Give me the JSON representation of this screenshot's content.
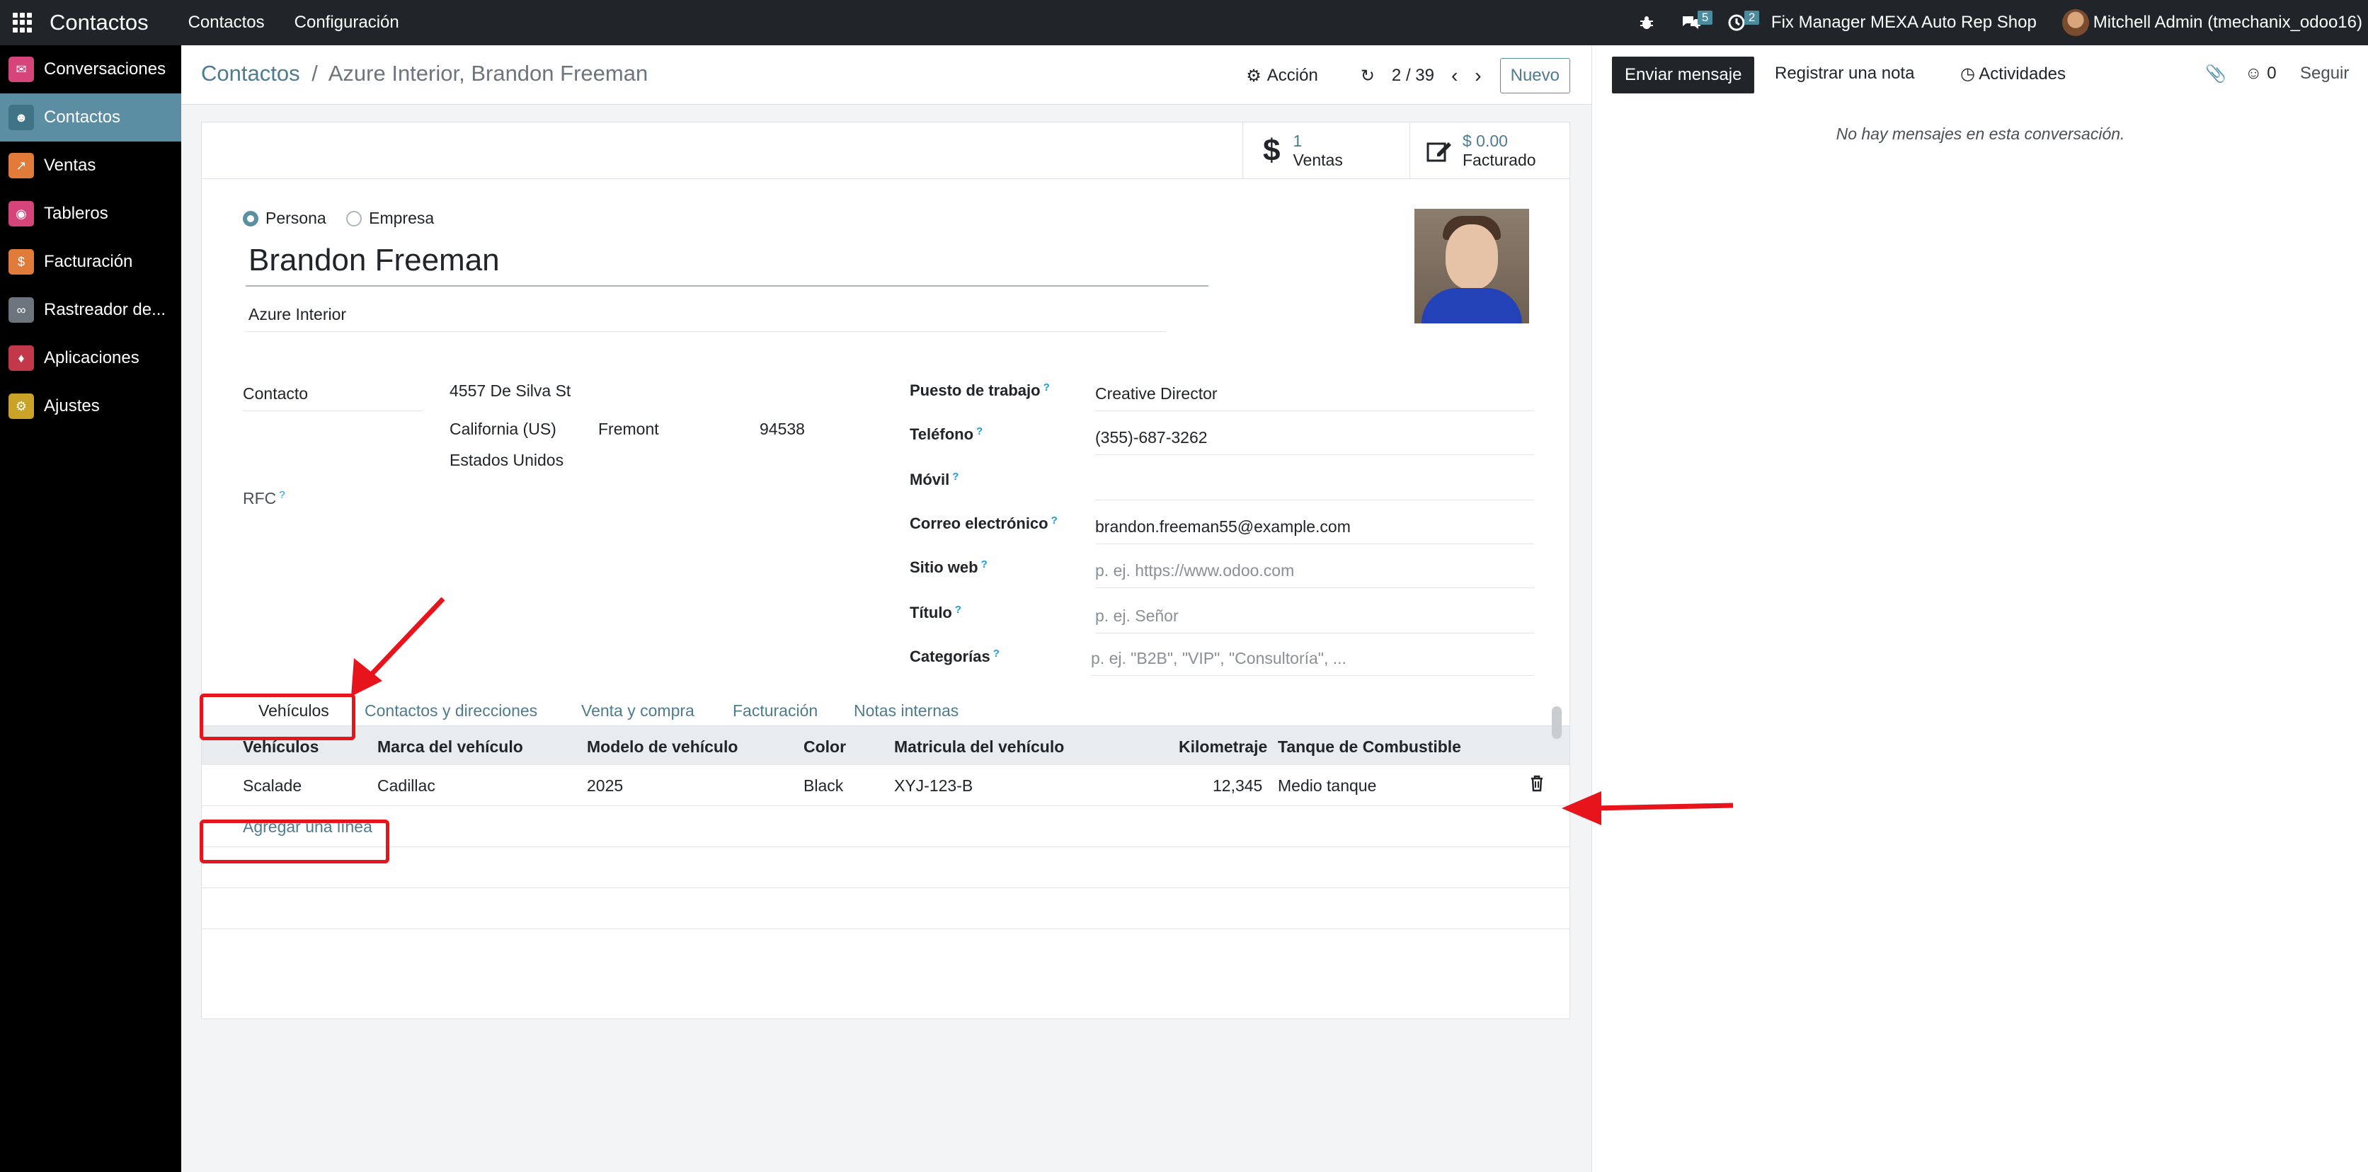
{
  "topbar": {
    "app_name": "Contactos",
    "menu": [
      "Contactos",
      "Configuración"
    ],
    "messages_badge": "5",
    "activities_badge": "2",
    "company": "Fix Manager MEXA Auto Rep Shop",
    "user": "Mitchell Admin (tmechanix_odoo16)"
  },
  "sidebar": {
    "items": [
      {
        "label": "Conversaciones",
        "color": "#d6457a",
        "icon": "chat-icon"
      },
      {
        "label": "Contactos",
        "color": "#5b8ea2",
        "icon": "contacts-icon"
      },
      {
        "label": "Ventas",
        "color": "#e07b39",
        "icon": "chart-icon"
      },
      {
        "label": "Tableros",
        "color": "#d6457a",
        "icon": "dashboard-icon"
      },
      {
        "label": "Facturación",
        "color": "#e07b39",
        "icon": "invoice-icon"
      },
      {
        "label": "Rastreador de...",
        "color": "#6c757d",
        "icon": "link-icon"
      },
      {
        "label": "Aplicaciones",
        "color": "#c2384a",
        "icon": "apps-icon"
      },
      {
        "label": "Ajustes",
        "color": "#c9a227",
        "icon": "gear-icon"
      }
    ]
  },
  "breadcrumb": {
    "root": "Contactos",
    "separator": "/",
    "current": "Azure Interior, Brandon Freeman"
  },
  "controls": {
    "action": "Acción",
    "pager": "2 / 39",
    "new": "Nuevo"
  },
  "stats": {
    "sales_count": "1",
    "sales_label": "Ventas",
    "invoiced_amount": "$ 0.00",
    "invoiced_label": "Facturado"
  },
  "form": {
    "type_person": "Persona",
    "type_company": "Empresa",
    "name": "Brandon Freeman",
    "company": "Azure Interior",
    "address_type": "Contacto",
    "street": "4557 De Silva St",
    "state": "California (US)",
    "city": "Fremont",
    "zip": "94538",
    "country": "Estados Unidos",
    "rfc_label": "RFC",
    "job_label": "Puesto de trabajo",
    "job_value": "Creative Director",
    "phone_label": "Teléfono",
    "phone_value": "(355)-687-3262",
    "mobile_label": "Móvil",
    "email_label": "Correo electrónico",
    "email_value": "brandon.freeman55@example.com",
    "website_label": "Sitio web",
    "website_placeholder": "p. ej. https://www.odoo.com",
    "title_label": "Título",
    "title_placeholder": "p. ej. Señor",
    "tags_label": "Categorías",
    "tags_placeholder": "p. ej. \"B2B\", \"VIP\", \"Consultoría\", ..."
  },
  "tabs": [
    "Vehículos",
    "Contactos y direcciones",
    "Venta y compra",
    "Facturación",
    "Notas internas"
  ],
  "vehicles": {
    "headers": [
      "Vehículos",
      "Marca del vehículo",
      "Modelo de vehículo",
      "Color",
      "Matricula del vehículo",
      "Kilometraje",
      "Tanque de Combustible"
    ],
    "rows": [
      [
        "Scalade",
        "Cadillac",
        "2025",
        "Black",
        "XYJ-123-B",
        "12,345",
        "Medio tanque"
      ]
    ],
    "add_line": "Agregar una línea"
  },
  "chatter": {
    "send": "Enviar mensaje",
    "note": "Registrar una nota",
    "activities": "Actividades",
    "followers": "0",
    "follow": "Seguir",
    "empty": "No hay mensajes en esta conversación."
  }
}
